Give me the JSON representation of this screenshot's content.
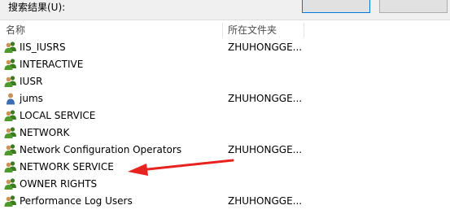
{
  "search_results_label": "搜索结果(U):",
  "columns": {
    "name": "名称",
    "folder": "所在文件夹"
  },
  "rows": [
    {
      "name": "IIS_IUSRS",
      "folder": "ZHUHONGGE...",
      "icon": "group-icon"
    },
    {
      "name": "INTERACTIVE",
      "folder": "",
      "icon": "group-icon"
    },
    {
      "name": "IUSR",
      "folder": "",
      "icon": "group-icon"
    },
    {
      "name": "jums",
      "folder": "ZHUHONGGE...",
      "icon": "user-icon"
    },
    {
      "name": "LOCAL SERVICE",
      "folder": "",
      "icon": "group-icon"
    },
    {
      "name": "NETWORK",
      "folder": "",
      "icon": "group-icon"
    },
    {
      "name": "Network Configuration Operators",
      "folder": "ZHUHONGGE...",
      "icon": "group-icon"
    },
    {
      "name": "NETWORK SERVICE",
      "folder": "",
      "icon": "group-icon"
    },
    {
      "name": "OWNER RIGHTS",
      "folder": "",
      "icon": "group-icon"
    },
    {
      "name": "Performance Log Users",
      "folder": "ZHUHONGGE...",
      "icon": "group-icon"
    }
  ],
  "colors": {
    "arrow": "#e8231f",
    "group_icon_green": "#4f9a2d",
    "user_icon_body": "#3b6db3"
  }
}
